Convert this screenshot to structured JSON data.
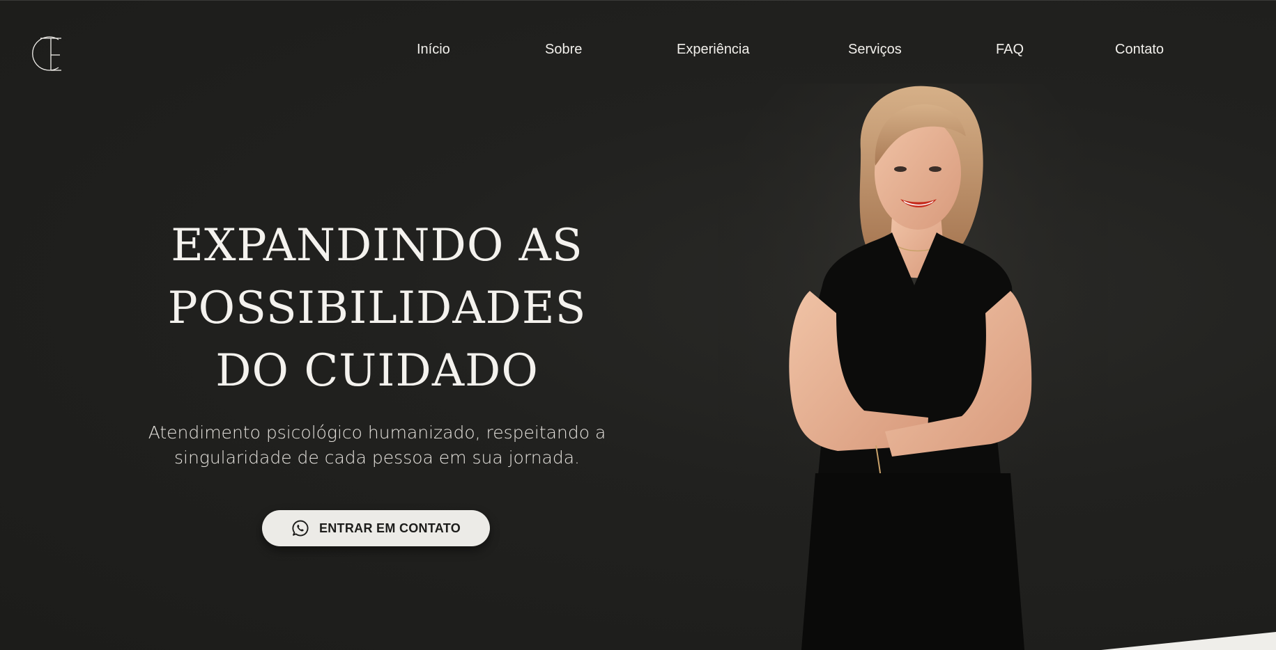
{
  "brand": {
    "logo_icon": "monogram-logo-icon"
  },
  "nav": {
    "items": [
      {
        "label": "Início"
      },
      {
        "label": "Sobre"
      },
      {
        "label": "Experiência"
      },
      {
        "label": "Serviços"
      },
      {
        "label": "FAQ"
      },
      {
        "label": "Contato"
      }
    ]
  },
  "hero": {
    "title_lines": [
      "EXPANDINDO AS",
      "POSSIBILIDADES",
      "DO CUIDADO"
    ],
    "subtitle_lines": [
      "Atendimento psicológico humanizado, respeitando a",
      "singularidade de cada pessoa em sua jornada."
    ],
    "cta": {
      "label": "ENTRAR EM CONTATO",
      "icon": "whatsapp-icon"
    },
    "portrait_icon": "portrait-photo"
  },
  "colors": {
    "background": "#1f1f1d",
    "text": "#f2f0ec",
    "button_bg": "#ecebe7",
    "button_text": "#1c1c1a"
  }
}
